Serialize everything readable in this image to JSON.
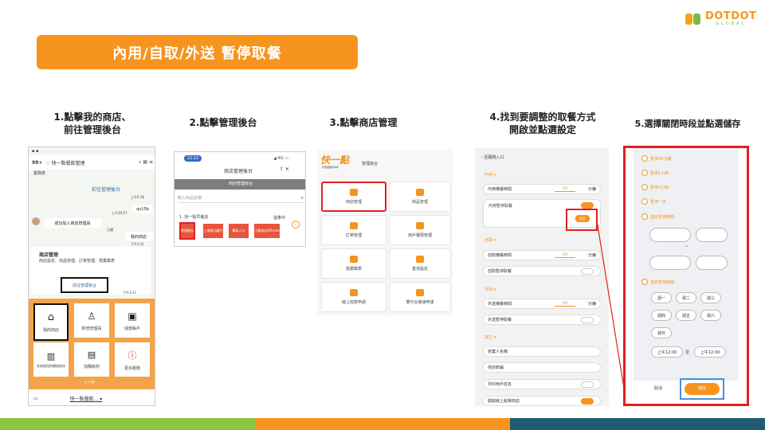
{
  "brand": {
    "name": "DOTDOT",
    "sub": "GLOBAL"
  },
  "title": "內用/自取/外送 暫停取餐",
  "steps": [
    {
      "label_l1": "1.點擊我的商店、",
      "label_l2": "前往管理後台"
    },
    {
      "label": "2.點擊管理後台"
    },
    {
      "label": "3.點擊商店管理"
    },
    {
      "label_l1": "4.找到要調整的取餐方式",
      "label_l2": "開啟並點選設定"
    },
    {
      "label": "5.選擇關閉時段並點選儲存"
    }
  ],
  "p1": {
    "status": "▪ ▪",
    "back": "99+",
    "chat_title": "♡ 快一點餐飲管理",
    "subtitle": "業務表",
    "link1": "前往管理後台",
    "time1": "上午6:18",
    "bubble": "qx15b",
    "time2": "上午10:57",
    "success": "成功加入商店管理員",
    "mystore_btn": "我的商店",
    "read": "已讀",
    "time3": "下午3:11",
    "card_title": "商店管理",
    "card_desc": "商店設定、商品管理、訂單管理、營業報表",
    "link2": "前往管理後台",
    "time4": "下午3:12",
    "menu": [
      "我的商店",
      "新增管理員",
      "儲值帳戶",
      "系統使用與播放秘技",
      "加購耗材",
      "更多服務"
    ],
    "badge": "◎ 小米",
    "bottom": "快一點餐飲... ▾"
  },
  "p2": {
    "time": "22:12",
    "signal": "◢ 4G ▭",
    "header": "商店管理後台",
    "bar": "商店管理後台",
    "search_placeholder": "輸入商品名稱",
    "store": "1. 快一點早餐店",
    "role": "還車中",
    "btns": [
      "管理後台",
      "上傳商品圖片",
      "購車入口",
      "下載商店QRcode"
    ]
  },
  "p3": {
    "brand": "快一點",
    "brand_sub": "智慧餐飲新革命",
    "header": "管理後台",
    "tiles": [
      "商店管理",
      "商品管理",
      "訂單管理",
      "用戶權限管理",
      "營業報表",
      "金流設定",
      "線上收款申請",
      "雙平台串接申請"
    ]
  },
  "p4": {
    "back": "‹ 回服務入口",
    "dine": "內用 ▾",
    "dine_time": "內用備餐時間",
    "dine_pause": "內用暫停取餐",
    "setting": "設定",
    "pickup": "自取 ▾",
    "pickup_time": "自取備餐時間",
    "pickup_pause": "自取暫停取餐",
    "delivery": "外送 ▾",
    "delivery_time": "外送備餐時間",
    "delivery_pause": "外送暫停取餐",
    "other": "其它 ▾",
    "r1": "營業人名稱",
    "r2": "商店統編",
    "r3": "列印用戶姓名",
    "r4": "開啟線上點單商店",
    "minutes_value": "20",
    "minutes_unit": "分鐘"
  },
  "p5": {
    "options": [
      "暫停30分鐘",
      "暫停1小時",
      "暫停2小時",
      "暫停一天",
      "指定暫停時間",
      "指定暫停週期"
    ],
    "tilde": "~",
    "weekdays": [
      "週一",
      "週二",
      "週三",
      "週四",
      "週五",
      "週六",
      "週日"
    ],
    "time_from": "上午12:00",
    "to": "至",
    "time_to": "上午12:00",
    "cancel": "取消",
    "save": "儲存"
  },
  "colors": {
    "orange": "#f7941d",
    "green": "#8cc63f",
    "teal": "#1f5c73",
    "red": "#e0201f",
    "blue": "#4a90d9"
  }
}
